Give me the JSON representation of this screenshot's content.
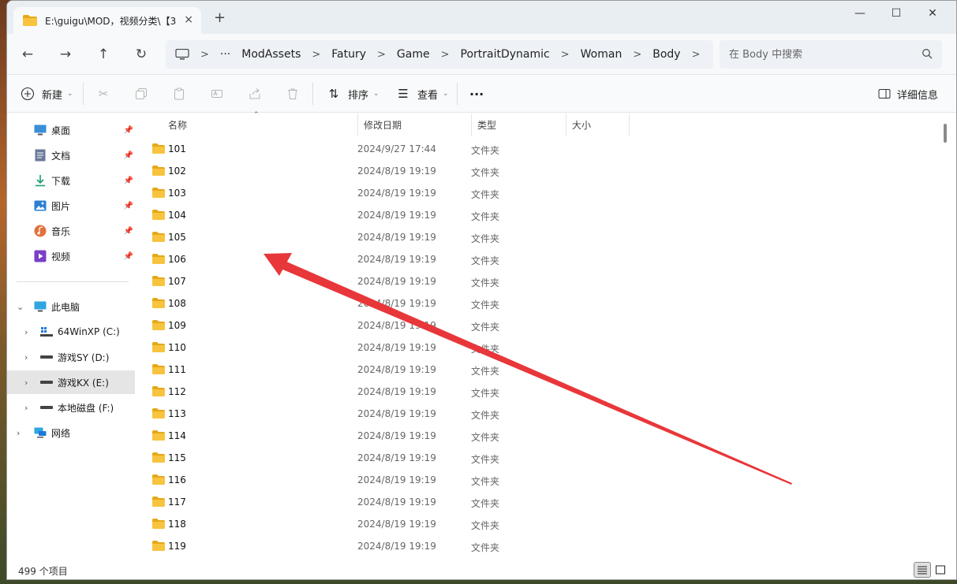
{
  "tab": {
    "title": "E:\\guigu\\MOD，视频分类\\【3",
    "close_icon": "×",
    "new_tab_icon": "+"
  },
  "window_controls": {
    "minimize": "—",
    "maximize": "☐",
    "close": "✕"
  },
  "nav": {
    "back": "←",
    "forward": "→",
    "up": "↑",
    "refresh": "↻"
  },
  "breadcrumb": {
    "overflow": "···",
    "separator": ">",
    "items": [
      "ModAssets",
      "Fatury",
      "Game",
      "PortraitDynamic",
      "Woman",
      "Body"
    ]
  },
  "search": {
    "placeholder": "在 Body 中搜索"
  },
  "toolbar": {
    "new_label": "新建",
    "sort_label": "排序",
    "view_label": "查看",
    "more_label": "···",
    "details_label": "详细信息"
  },
  "sidebar": {
    "quick_access": [
      {
        "label": "桌面",
        "icon": "desktop-icon"
      },
      {
        "label": "文档",
        "icon": "documents-icon"
      },
      {
        "label": "下载",
        "icon": "downloads-icon"
      },
      {
        "label": "图片",
        "icon": "pictures-icon"
      },
      {
        "label": "音乐",
        "icon": "music-icon"
      },
      {
        "label": "视频",
        "icon": "videos-icon"
      }
    ],
    "this_pc_label": "此电脑",
    "drives": [
      {
        "label": "64WinXP  (C:)"
      },
      {
        "label": "游戏SY (D:)"
      },
      {
        "label": "游戏KX (E:)",
        "selected": true
      },
      {
        "label": "本地磁盘 (F:)"
      }
    ],
    "network_label": "网络"
  },
  "columns": {
    "name": "名称",
    "date": "修改日期",
    "type": "类型",
    "size": "大小"
  },
  "rows": [
    {
      "name": "101",
      "date": "2024/9/27 17:44",
      "type": "文件夹"
    },
    {
      "name": "102",
      "date": "2024/8/19 19:19",
      "type": "文件夹"
    },
    {
      "name": "103",
      "date": "2024/8/19 19:19",
      "type": "文件夹"
    },
    {
      "name": "104",
      "date": "2024/8/19 19:19",
      "type": "文件夹"
    },
    {
      "name": "105",
      "date": "2024/8/19 19:19",
      "type": "文件夹"
    },
    {
      "name": "106",
      "date": "2024/8/19 19:19",
      "type": "文件夹"
    },
    {
      "name": "107",
      "date": "2024/8/19 19:19",
      "type": "文件夹"
    },
    {
      "name": "108",
      "date": "2024/8/19 19:19",
      "type": "文件夹"
    },
    {
      "name": "109",
      "date": "2024/8/19 19:19",
      "type": "文件夹"
    },
    {
      "name": "110",
      "date": "2024/8/19 19:19",
      "type": "文件夹"
    },
    {
      "name": "111",
      "date": "2024/8/19 19:19",
      "type": "文件夹"
    },
    {
      "name": "112",
      "date": "2024/8/19 19:19",
      "type": "文件夹"
    },
    {
      "name": "113",
      "date": "2024/8/19 19:19",
      "type": "文件夹"
    },
    {
      "name": "114",
      "date": "2024/8/19 19:19",
      "type": "文件夹"
    },
    {
      "name": "115",
      "date": "2024/8/19 19:19",
      "type": "文件夹"
    },
    {
      "name": "116",
      "date": "2024/8/19 19:19",
      "type": "文件夹"
    },
    {
      "name": "117",
      "date": "2024/8/19 19:19",
      "type": "文件夹"
    },
    {
      "name": "118",
      "date": "2024/8/19 19:19",
      "type": "文件夹"
    },
    {
      "name": "119",
      "date": "2024/8/19 19:19",
      "type": "文件夹"
    }
  ],
  "status": {
    "item_count": "499 个项目"
  },
  "colors": {
    "folder": "#F8C33E",
    "folder_dark": "#E6A817",
    "annotation_arrow": "#E8373A",
    "selected_bg": "#E5E5E5"
  }
}
